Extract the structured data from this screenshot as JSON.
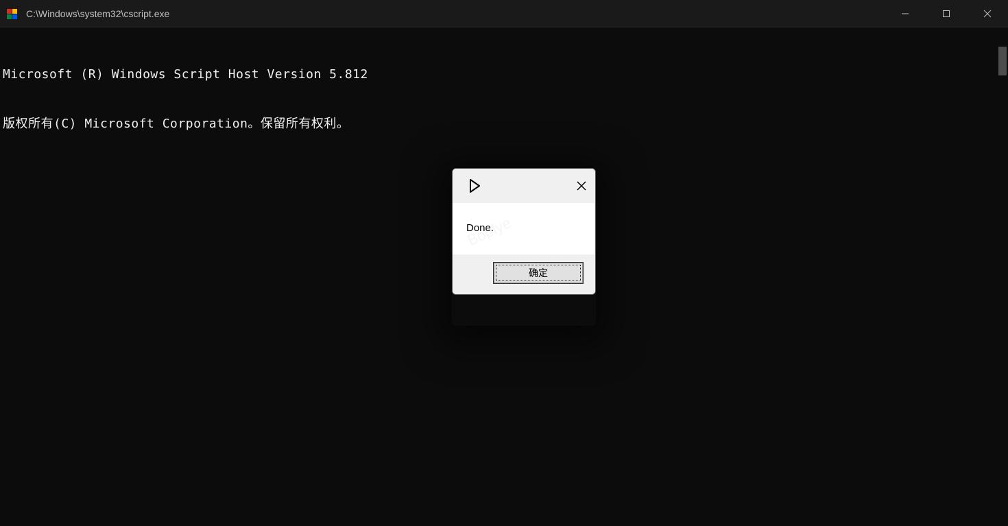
{
  "window": {
    "title": "C:\\Windows\\system32\\cscript.exe"
  },
  "console": {
    "line1": "Microsoft (R) Windows Script Host Version 5.812",
    "line2": "版权所有(C) Microsoft Corporation。保留所有权利。"
  },
  "dialog": {
    "message": "Done.",
    "ok_button": "确定"
  },
  "watermark": "Boplye"
}
